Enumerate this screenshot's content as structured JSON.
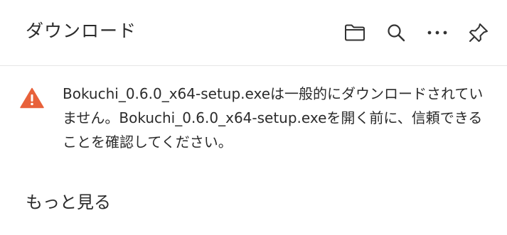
{
  "header": {
    "title": "ダウンロード",
    "tools": [
      {
        "icon": "folder-icon"
      },
      {
        "icon": "search-icon"
      },
      {
        "icon": "more-options-icon"
      },
      {
        "icon": "pin-icon"
      }
    ]
  },
  "warning": {
    "icon": "warning-icon",
    "icon_color": "#e8613a",
    "message": "Bokuchi_0.6.0_x64-setup.exeは一般的にダウンロードされていません。Bokuchi_0.6.0_x64-setup.exeを開く前に、信頼できることを確認してください。"
  },
  "footer": {
    "more_label": "もっと見る"
  }
}
